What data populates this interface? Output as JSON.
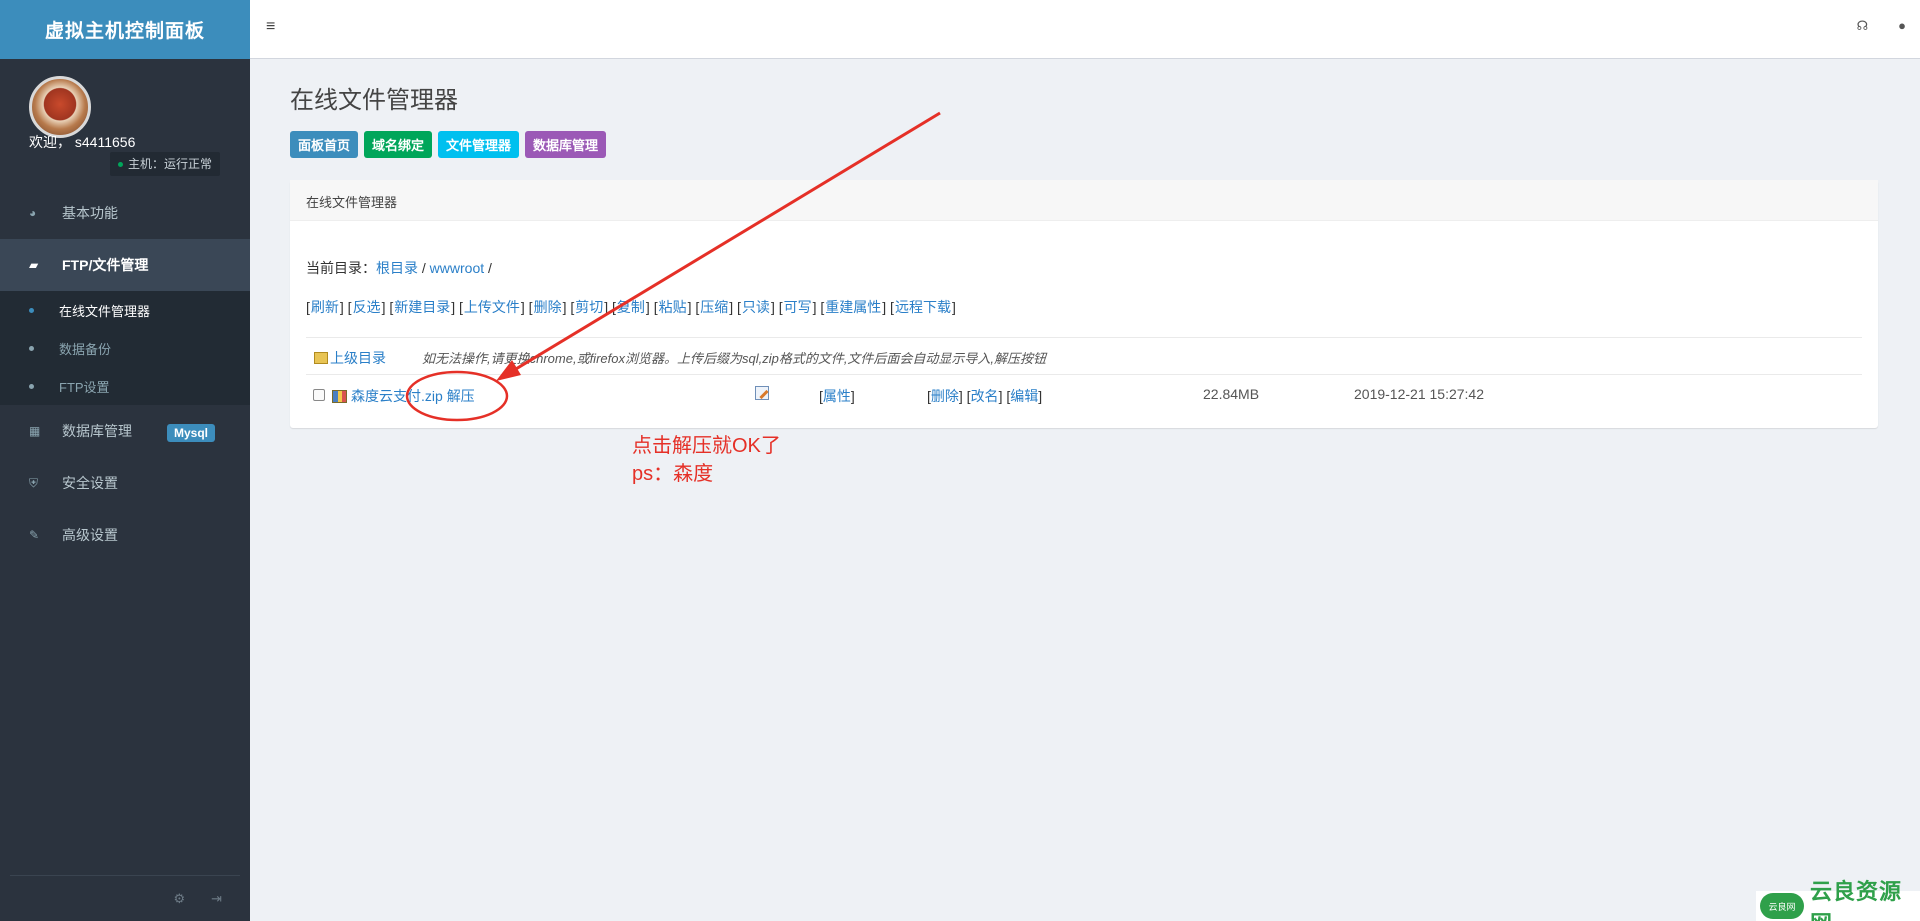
{
  "sidebar": {
    "brand": "虚拟主机控制面板",
    "welcome": "欢迎，  s4411656",
    "status": "主机：运行正常",
    "items": [
      {
        "label": "基本功能"
      },
      {
        "label": "FTP/文件管理"
      },
      {
        "label": "数据库管理",
        "badge": "Mysql"
      },
      {
        "label": "安全设置"
      },
      {
        "label": "高级设置"
      }
    ],
    "sub_items": [
      {
        "label": "在线文件管理器"
      },
      {
        "label": "数据备份"
      },
      {
        "label": "FTP设置"
      }
    ]
  },
  "page": {
    "title": "在线文件管理器",
    "quick_buttons": [
      {
        "label": "面板首页",
        "color": "#3c8dbc"
      },
      {
        "label": "域名绑定",
        "color": "#00a65a"
      },
      {
        "label": "文件管理器",
        "color": "#00c0ef"
      },
      {
        "label": "数据库管理",
        "color": "#9b59b6"
      }
    ],
    "box_title": "在线文件管理器",
    "current_dir_label": "当前目录：",
    "crumb_root": "根目录",
    "crumb_sep": " / ",
    "crumb_wwwroot": "wwwroot",
    "crumb_tail": " /",
    "actions": [
      "刷新",
      "反选",
      "新建目录",
      "上传文件",
      "删除",
      "剪切",
      "复制",
      "粘贴",
      "压缩",
      "只读",
      "可写",
      "重建属性",
      "远程下载"
    ],
    "parent_dir": "上级目录",
    "hint": "如无法操作,请更换chrome,或firefox浏览器。上传后缀为sql,zip格式的文件,文件后面会自动显示导入,解压按钮",
    "file": {
      "name": "森度云支付.zip",
      "unzip": "解压",
      "props": "属性",
      "delete": "删除",
      "rename": "改名",
      "edit": "编辑",
      "size": "22.84MB",
      "modified": "2019-12-21 15:27:42"
    }
  },
  "annotation": {
    "line1": "点击解压就OK了",
    "line2": "ps：森度",
    "color": "#e53027"
  },
  "watermark": {
    "cloud_text": "云良网",
    "text": "云良资源网"
  }
}
